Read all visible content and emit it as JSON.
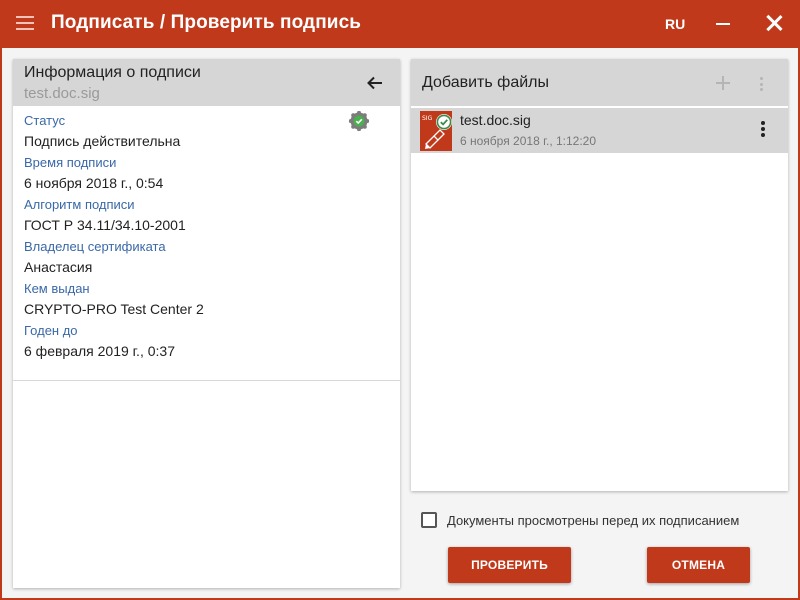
{
  "window": {
    "title": "Подписать / Проверить подпись",
    "language": "RU",
    "accent_color": "#c0391b",
    "icons": [
      "menu-icon",
      "minimize-icon",
      "close-icon"
    ]
  },
  "signature_info": {
    "header_title": "Информация о подписи",
    "file_name": "test.doc.sig",
    "back_icon": "arrow-left-icon",
    "status_icon": "verified-badge-icon",
    "fields": [
      {
        "label": "Статус",
        "value": "Подпись действительна"
      },
      {
        "label": "Время подписи",
        "value": "6 ноября 2018 г., 0:54"
      },
      {
        "label": "Алгоритм подписи",
        "value": "ГОСТ Р 34.11/34.10-2001"
      },
      {
        "label": "Владелец сертификата",
        "value": "Анастасия"
      },
      {
        "label": "Кем выдан",
        "value": "CRYPTO-PRO Test Center 2"
      },
      {
        "label": "Годен до",
        "value": "6 февраля 2019 г., 0:37"
      }
    ],
    "label_color": "#3a68a8"
  },
  "files_panel": {
    "header_title": "Добавить файлы",
    "add_icon": "plus-icon",
    "more_icon": "more-vertical-icon",
    "files": [
      {
        "name": "test.doc.sig",
        "date": "6 ноября 2018 г., 1:12:20",
        "icon_badge": "SIG",
        "status": "verified"
      }
    ]
  },
  "footer": {
    "checkbox_label": "Документы просмотрены перед их подписанием",
    "checkbox_checked": false,
    "verify_button": "ПРОВЕРИТЬ",
    "cancel_button": "ОТМЕНА"
  }
}
